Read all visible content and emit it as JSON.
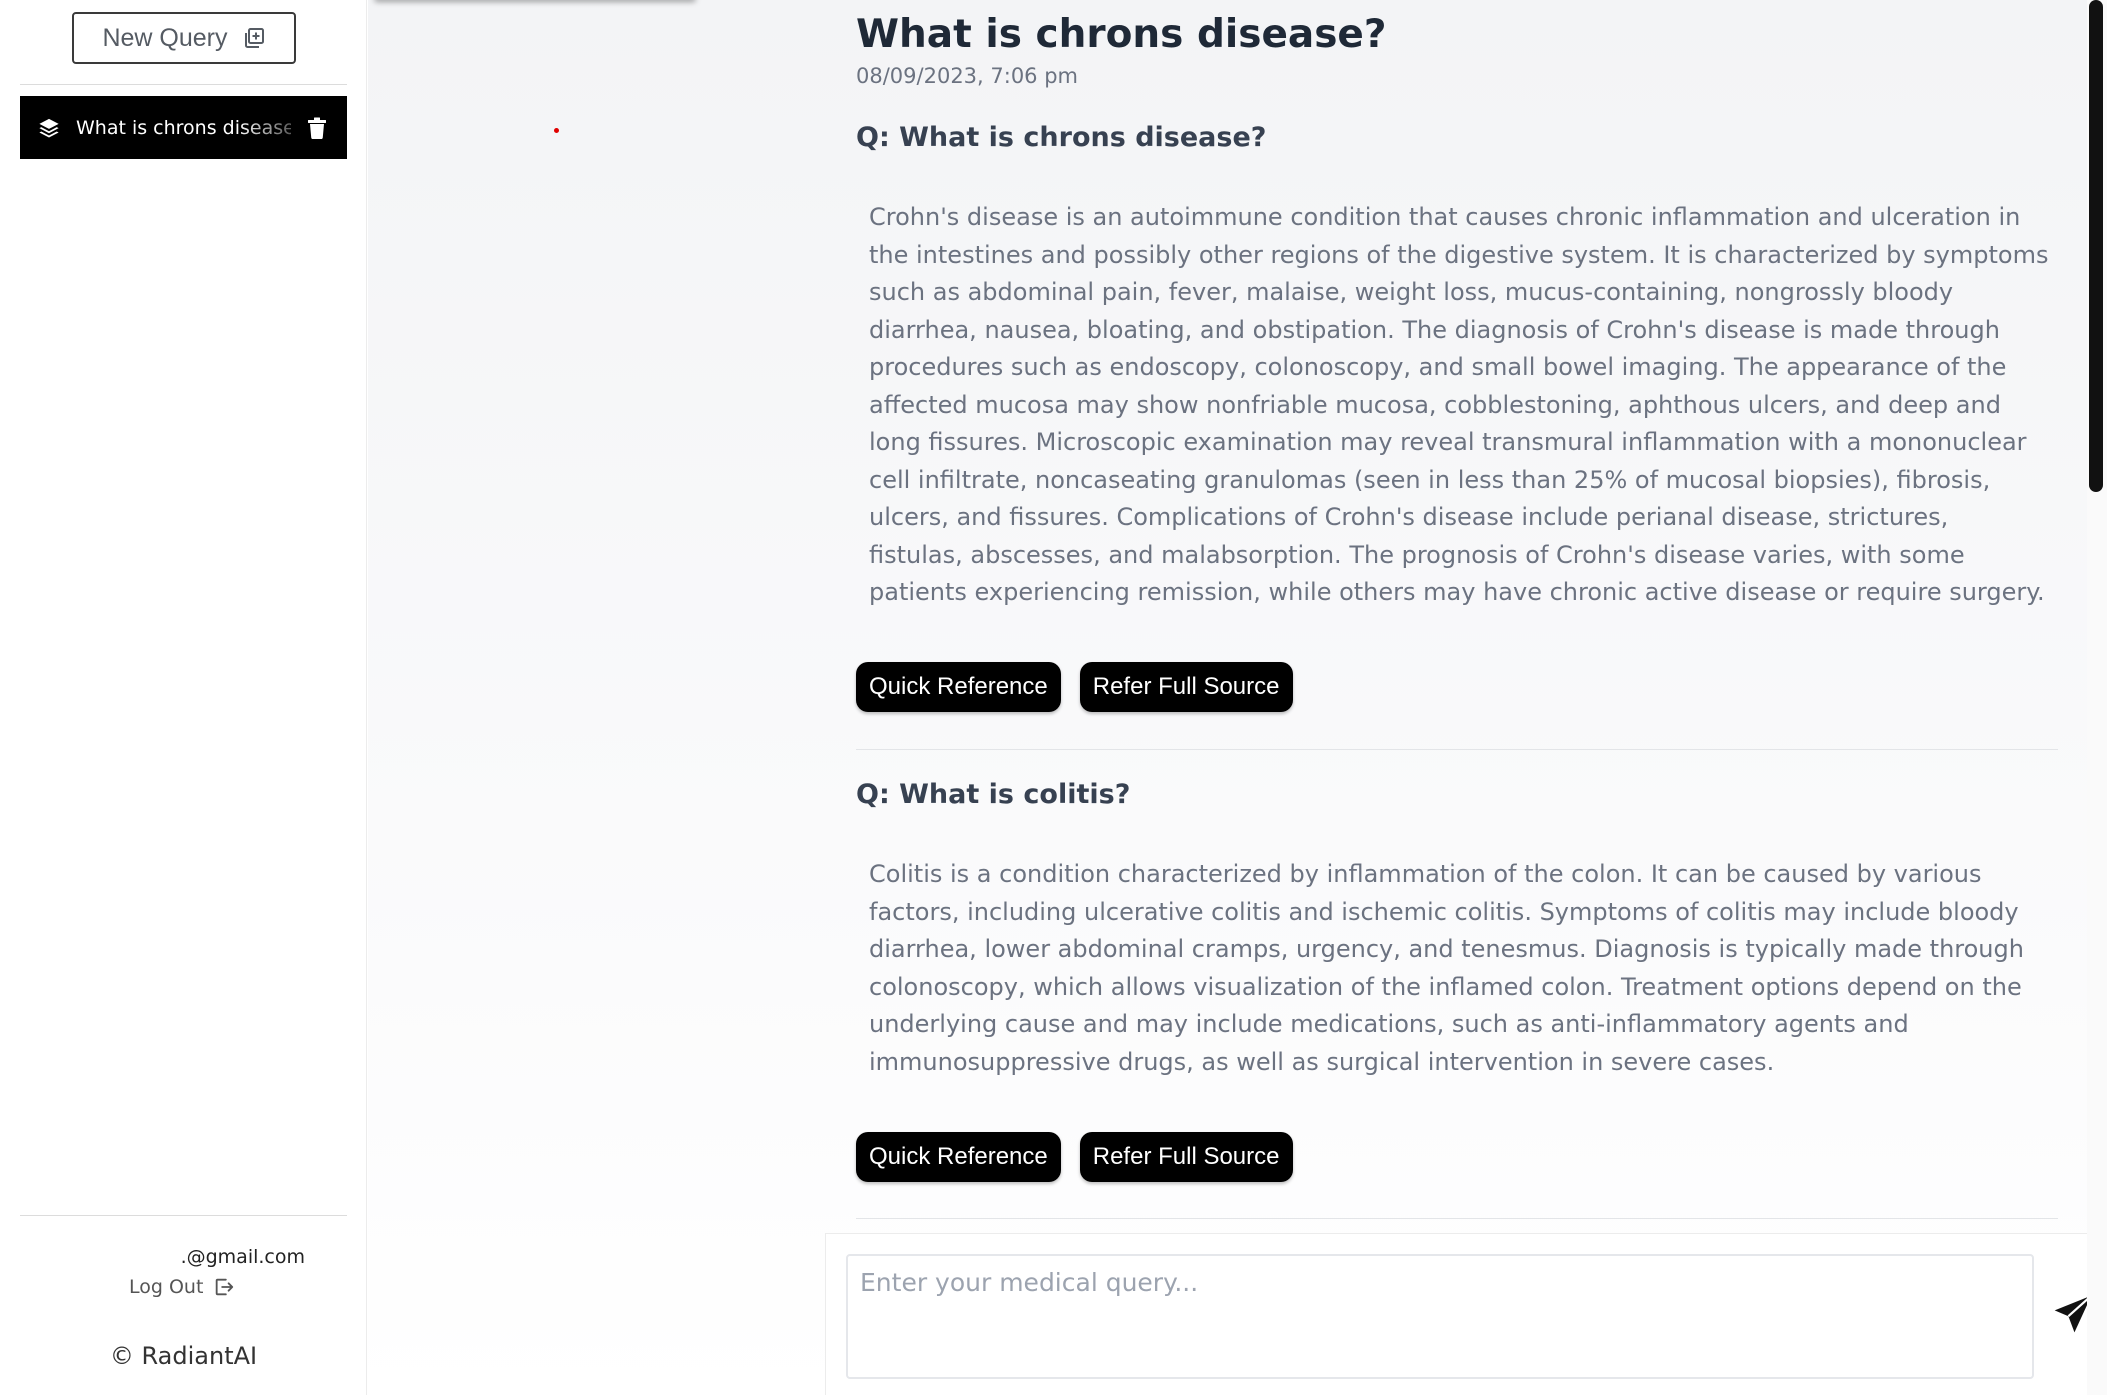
{
  "sidebar": {
    "new_query_label": "New Query",
    "history": [
      {
        "label": "What is chrons disease?"
      }
    ],
    "user_email": ".@gmail.com",
    "logout_label": "Log Out",
    "copyright": "© RadiantAI"
  },
  "main": {
    "title": "What is chrons disease?",
    "timestamp": "08/09/2023, 7:06 pm",
    "qa": [
      {
        "question": "Q: What is chrons disease?",
        "answer": "Crohn's disease is an autoimmune condition that causes chronic inflammation and ulceration in the intestines and possibly other regions of the digestive system. It is characterized by symptoms such as abdominal pain, fever, malaise, weight loss, mucus-containing, nongrossly bloody diarrhea, nausea, bloating, and obstipation. The diagnosis of Crohn's disease is made through procedures such as endoscopy, colonoscopy, and small bowel imaging. The appearance of the affected mucosa may show nonfriable mucosa, cobblestoning, aphthous ulcers, and deep and long fissures. Microscopic examination may reveal transmural inflammation with a mononuclear cell infiltrate, noncaseating granulomas (seen in less than 25% of mucosal biopsies), fibrosis, ulcers, and fissures. Complications of Crohn's disease include perianal disease, strictures, fistulas, abscesses, and malabsorption. The prognosis of Crohn's disease varies, with some patients experiencing remission, while others may have chronic active disease or require surgery.",
        "quick_reference_label": "Quick Reference",
        "full_source_label": "Refer Full Source"
      },
      {
        "question": "Q: What is colitis?",
        "answer": "Colitis is a condition characterized by inflammation of the colon. It can be caused by various factors, including ulcerative colitis and ischemic colitis. Symptoms of colitis may include bloody diarrhea, lower abdominal cramps, urgency, and tenesmus. Diagnosis is typically made through colonoscopy, which allows visualization of the inflamed colon. Treatment options depend on the underlying cause and may include medications, such as anti-inflammatory agents and immunosuppressive drugs, as well as surgical intervention in severe cases.",
        "quick_reference_label": "Quick Reference",
        "full_source_label": "Refer Full Source"
      }
    ]
  },
  "input": {
    "placeholder": "Enter your medical query...",
    "value": ""
  },
  "icons": {
    "new_query": "add-square-icon",
    "history": "layers-icon",
    "delete": "trash-icon",
    "logout": "logout-icon",
    "send": "send-icon"
  }
}
